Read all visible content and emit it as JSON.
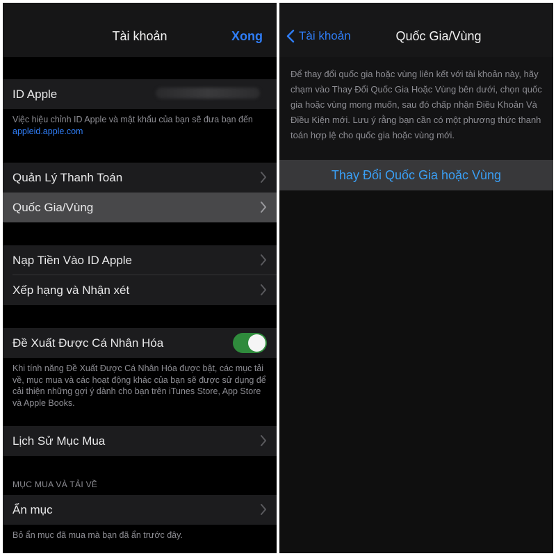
{
  "left": {
    "nav": {
      "title": "Tài khoản",
      "done": "Xong"
    },
    "apple_id": {
      "label": "ID Apple"
    },
    "apple_id_note": {
      "text": "Việc hiệu chỉnh ID Apple và mật khẩu của bạn sẽ đưa bạn đến ",
      "link": "appleid.apple.com"
    },
    "rows": {
      "payment": "Quản Lý Thanh Toán",
      "region": "Quốc Gia/Vùng",
      "add_funds": "Nạp Tiền Vào ID Apple",
      "ratings": "Xếp hạng và Nhận xét",
      "personalized": "Đề Xuất Được Cá Nhân Hóa",
      "history": "Lịch Sử Mục Mua",
      "hide": "Ẩn mục"
    },
    "personalized_on": true,
    "personalized_note": "Khi tính năng Đề Xuất Được Cá Nhân Hóa được bật, các mục tải về, mục mua và các hoạt động khác của bạn sẽ được sử dụng để cải thiện những gợi ý dành cho bạn trên iTunes Store, App Store và Apple Books.",
    "section_header": "MỤC MUA VÀ TẢI VỀ",
    "hide_note": "Bỏ ẩn mục đã mua mà bạn đã ẩn trước đây."
  },
  "right": {
    "nav": {
      "back": "Tài khoản",
      "title": "Quốc Gia/Vùng"
    },
    "note": "Để thay đổi quốc gia hoặc vùng liên kết với tài khoản này, hãy chạm vào Thay Đổi Quốc Gia Hoặc Vùng bên dưới, chọn quốc gia hoặc vùng mong muốn, sau đó chấp nhận Điều Khoản Và Điều Kiện mới. Lưu ý rằng bạn cần có một phương thức thanh toán hợp lệ cho quốc gia hoặc vùng mới.",
    "action": "Thay Đổi Quốc Gia hoặc Vùng"
  },
  "colors": {
    "accent": "#2f7df6",
    "toggle_on": "#2f8b3c",
    "action_text": "#3a9ff5"
  }
}
